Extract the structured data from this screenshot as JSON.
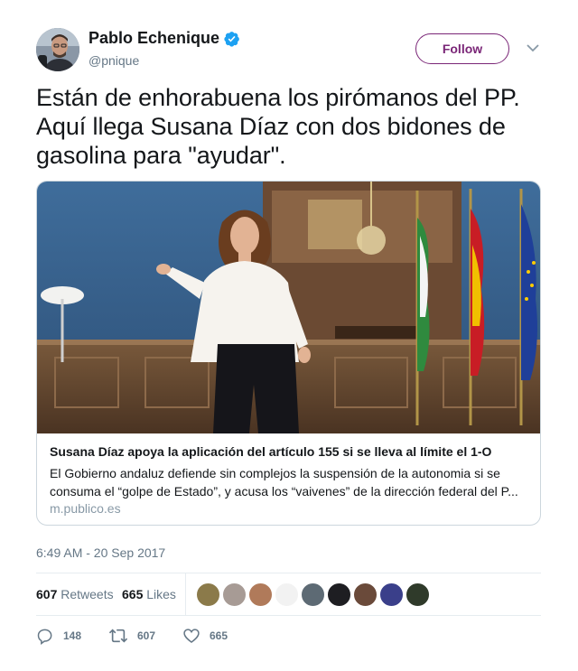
{
  "author": {
    "name": "Pablo Echenique",
    "handle": "@pnique",
    "verified": true
  },
  "follow_label": "Follow",
  "tweet_text": "Están de enhorabuena los pirómanos del PP. Aquí llega Susana Díaz con dos bidones de gasolina para \"ayudar\".",
  "card": {
    "title": "Susana Díaz apoya la aplicación del artículo 155 si se lleva al límite el 1-O",
    "description": "El Gobierno andaluz defiende sin complejos la suspensión de la autonomia si se consuma el “golpe de Estado”, y acusa los “vaivenes” de la dirección federal del P...",
    "domain": "m.publico.es"
  },
  "timestamp": "6:49 AM - 20 Sep 2017",
  "stats": {
    "retweets_count": "607",
    "retweets_label": "Retweets",
    "likes_count": "665",
    "likes_label": "Likes"
  },
  "actions": {
    "replies": "148",
    "retweets": "607",
    "likes": "665"
  },
  "colors": {
    "follow_accent": "#7a2677",
    "verified_blue": "#1da1f2",
    "muted_text": "#657786",
    "border": "#e6ecf0"
  },
  "icons": [
    "verified-badge-icon",
    "chevron-down-icon",
    "reply-icon",
    "retweet-icon",
    "like-icon"
  ]
}
